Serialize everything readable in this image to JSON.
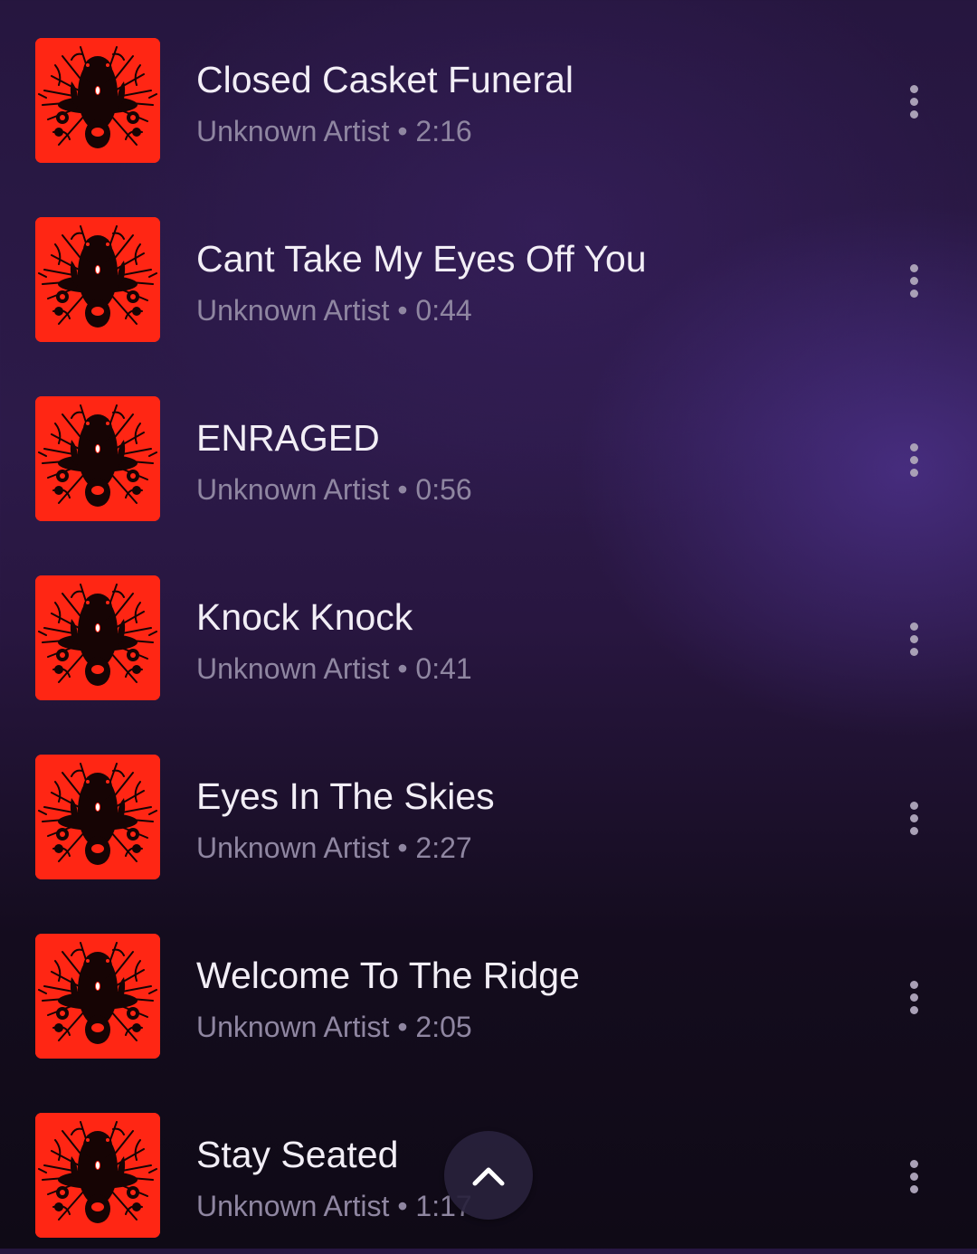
{
  "tracks": [
    {
      "title": "Closed Casket Funeral",
      "artist": "Unknown Artist",
      "separator": "•",
      "duration": "2:16"
    },
    {
      "title": "Cant Take My Eyes Off You",
      "artist": "Unknown Artist",
      "separator": "•",
      "duration": "0:44"
    },
    {
      "title": "ENRAGED",
      "artist": "Unknown Artist",
      "separator": "•",
      "duration": "0:56"
    },
    {
      "title": "Knock Knock",
      "artist": "Unknown Artist",
      "separator": "•",
      "duration": "0:41"
    },
    {
      "title": "Eyes In The Skies",
      "artist": "Unknown Artist",
      "separator": "•",
      "duration": "2:27"
    },
    {
      "title": "Welcome To The Ridge",
      "artist": "Unknown Artist",
      "separator": "•",
      "duration": "2:05"
    },
    {
      "title": "Stay Seated",
      "artist": "Unknown Artist",
      "separator": "•",
      "duration": "1:17"
    }
  ],
  "icons": {
    "more": "more-vertical-icon",
    "scroll_top": "chevron-up-icon",
    "cover": "album-art"
  },
  "colors": {
    "cover_background": "#ff2614",
    "title_text": "#f2eef6",
    "meta_text": "#8f86a1"
  }
}
